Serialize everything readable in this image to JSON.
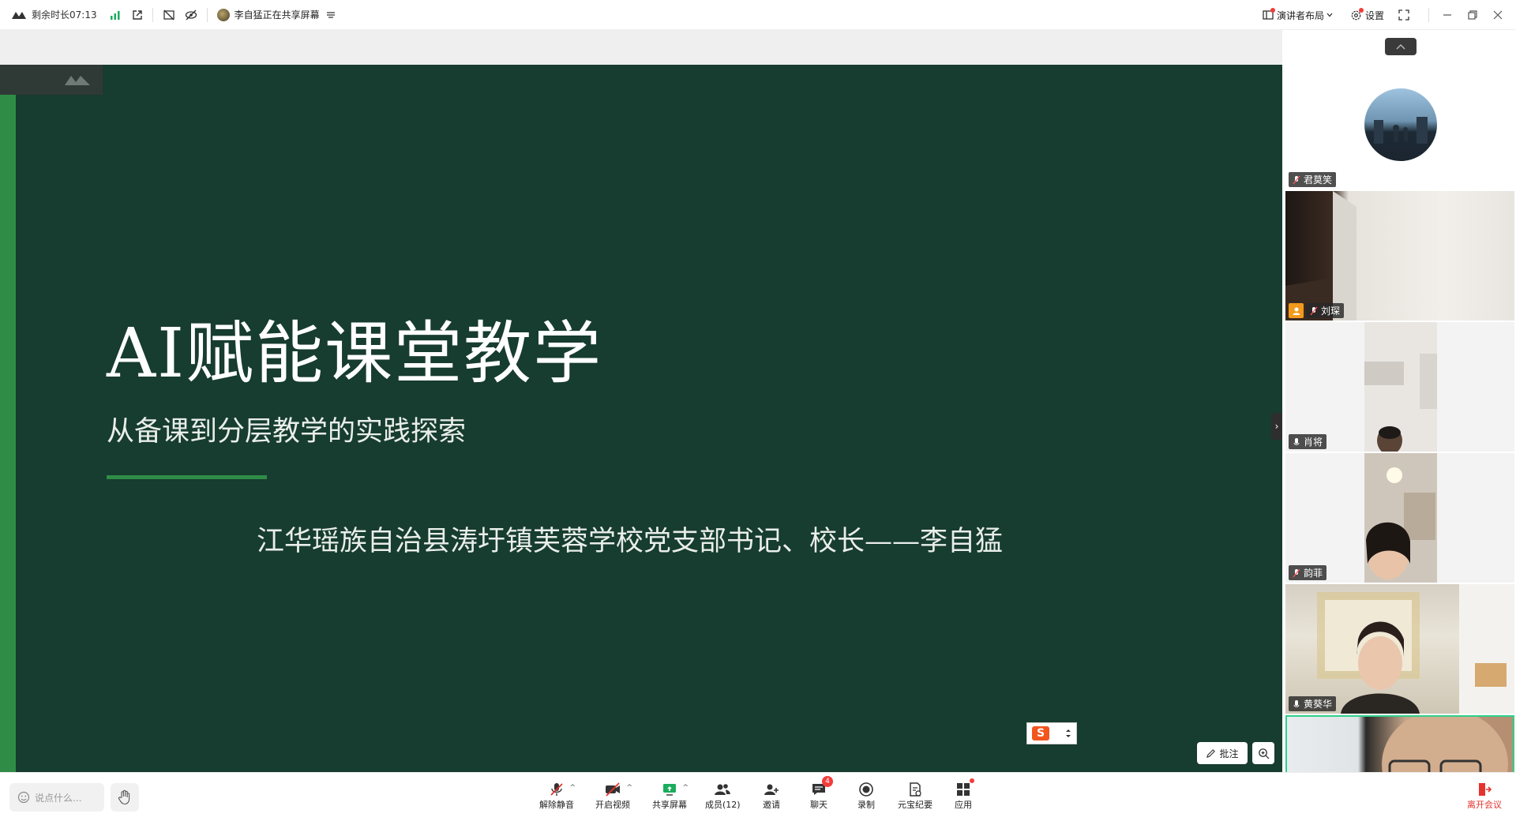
{
  "topbar": {
    "remaining_time": "剩余时长07:13",
    "sharing_status": "李自猛正在共享屏幕",
    "layout_label": "演讲者布局",
    "settings_label": "设置"
  },
  "slide": {
    "title": "AI赋能课堂教学",
    "subtitle": "从备课到分层教学的实践探索",
    "author_line": "江华瑶族自治县涛圩镇芙蓉学校党支部书记、校长——李自猛"
  },
  "stage_controls": {
    "annotate_label": "批注",
    "ime_letter": "S"
  },
  "participants": [
    {
      "name": "君莫笑",
      "muted": true
    },
    {
      "name": "刘琛",
      "muted": true,
      "host": true
    },
    {
      "name": "肖将",
      "muted": false
    },
    {
      "name": "韵菲",
      "muted": true
    },
    {
      "name": "黄葵华",
      "muted": false
    },
    {
      "name": "",
      "muted": false,
      "active_speaker": true
    }
  ],
  "bottombar": {
    "chat_placeholder": "说点什么...",
    "controls": {
      "unmute": "解除静音",
      "start_video": "开启视频",
      "share_screen": "共享屏幕",
      "members": "成员(12)",
      "invite": "邀请",
      "chat": "聊天",
      "chat_badge": "4",
      "record": "录制",
      "ai_minutes": "元宝纪要",
      "apps": "应用"
    },
    "leave": "离开会议"
  },
  "colors": {
    "slide_bg": "#173c30",
    "slide_accent": "#2f8c46",
    "active_speaker_border": "#2fd08b",
    "leave_red": "#e5322d",
    "brand_green": "#1aad5c"
  }
}
